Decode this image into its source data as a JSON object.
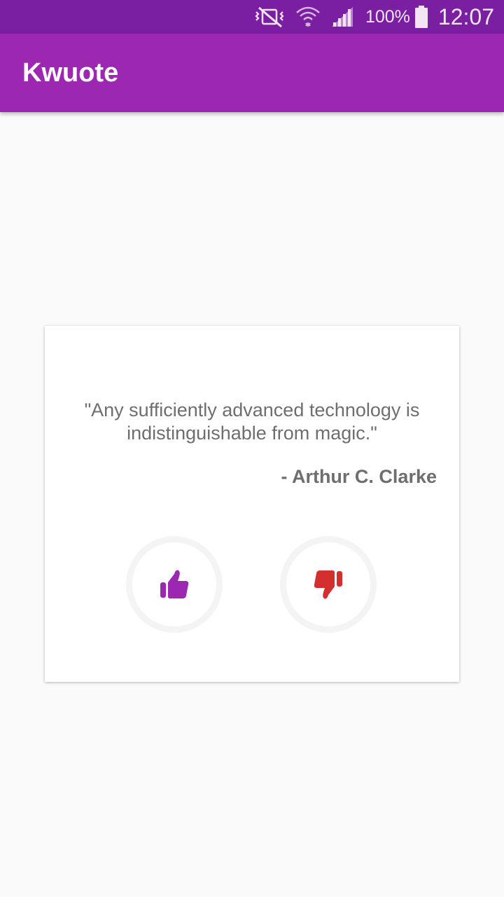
{
  "status_bar": {
    "battery_percent": "100%",
    "time": "12:07",
    "icons": [
      "vibrate-off-icon",
      "wifi-icon",
      "signal-icon",
      "battery-icon"
    ]
  },
  "app_bar": {
    "title": "Kwuote"
  },
  "quote": {
    "text": "\"Any sufficiently advanced technology is indistinguishable from magic.\"",
    "author": "- Arthur C. Clarke"
  },
  "actions": {
    "like_icon": "thumbs-up-icon",
    "dislike_icon": "thumbs-down-icon"
  },
  "colors": {
    "status_bar": "#7b1fa2",
    "app_bar": "#9c27b0",
    "like": "#9c27b0",
    "dislike": "#d32f2f",
    "quote_text": "#6e6e6e",
    "background": "#fafafa"
  }
}
